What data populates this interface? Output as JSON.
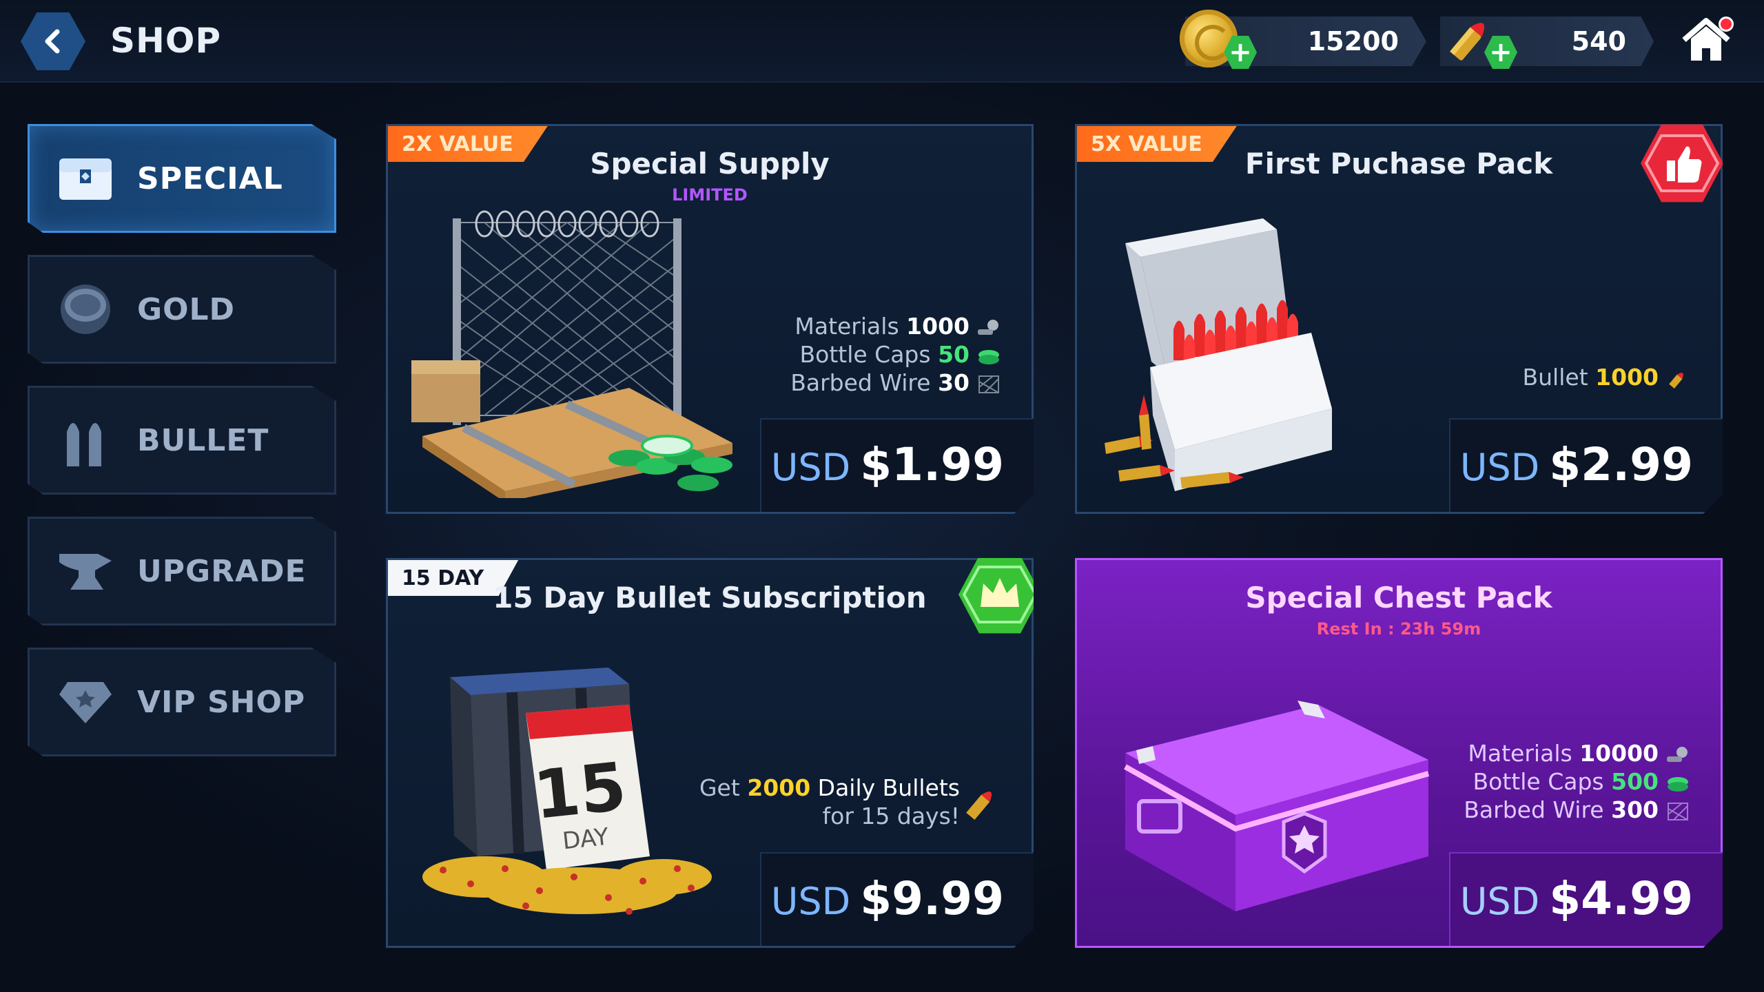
{
  "header": {
    "title": "SHOP",
    "gold_amount": "15200",
    "bullet_amount": "540"
  },
  "sidebar": {
    "items": [
      {
        "label": "SPECIAL",
        "icon": "chest-icon",
        "active": true
      },
      {
        "label": "GOLD",
        "icon": "coin-icon",
        "active": false
      },
      {
        "label": "BULLET",
        "icon": "bullets-icon",
        "active": false
      },
      {
        "label": "UPGRADE",
        "icon": "anvil-icon",
        "active": false
      },
      {
        "label": "VIP SHOP",
        "icon": "diamond-icon",
        "active": false
      }
    ]
  },
  "cards": {
    "special_supply": {
      "tag": "2X VALUE",
      "title": "Special Supply",
      "subtitle": "LIMITED",
      "items": [
        {
          "name": "Materials",
          "amount": "1000"
        },
        {
          "name": "Bottle Caps",
          "amount": "50"
        },
        {
          "name": "Barbed Wire",
          "amount": "30"
        }
      ],
      "currency": "USD",
      "price": "$1.99"
    },
    "first_purchase": {
      "tag": "5X VALUE",
      "title": "First Puchase Pack",
      "items": [
        {
          "name": "Bullet",
          "amount": "1000"
        }
      ],
      "currency": "USD",
      "price": "$2.99"
    },
    "subscription": {
      "tag": "15 DAY",
      "title": "15 Day Bullet Subscription",
      "desc_prefix": "Get",
      "desc_amount": "2000",
      "desc_suffix": "Daily Bullets",
      "desc_line2": "for 15 days!",
      "calendar_number": "15",
      "calendar_label": "DAY",
      "currency": "USD",
      "price": "$9.99"
    },
    "chest_pack": {
      "title": "Special Chest Pack",
      "subtitle": "Rest In : 23h 59m",
      "items": [
        {
          "name": "Materials",
          "amount": "10000"
        },
        {
          "name": "Bottle Caps",
          "amount": "500"
        },
        {
          "name": "Barbed Wire",
          "amount": "300"
        }
      ],
      "currency": "USD",
      "price": "$4.99"
    }
  },
  "colors": {
    "accent_blue": "#3d8fe0",
    "tag_orange": "#ff6a1a",
    "green_value": "#46e37a",
    "gold_value": "#ffd12a",
    "purple_card": "#7b22c4"
  }
}
